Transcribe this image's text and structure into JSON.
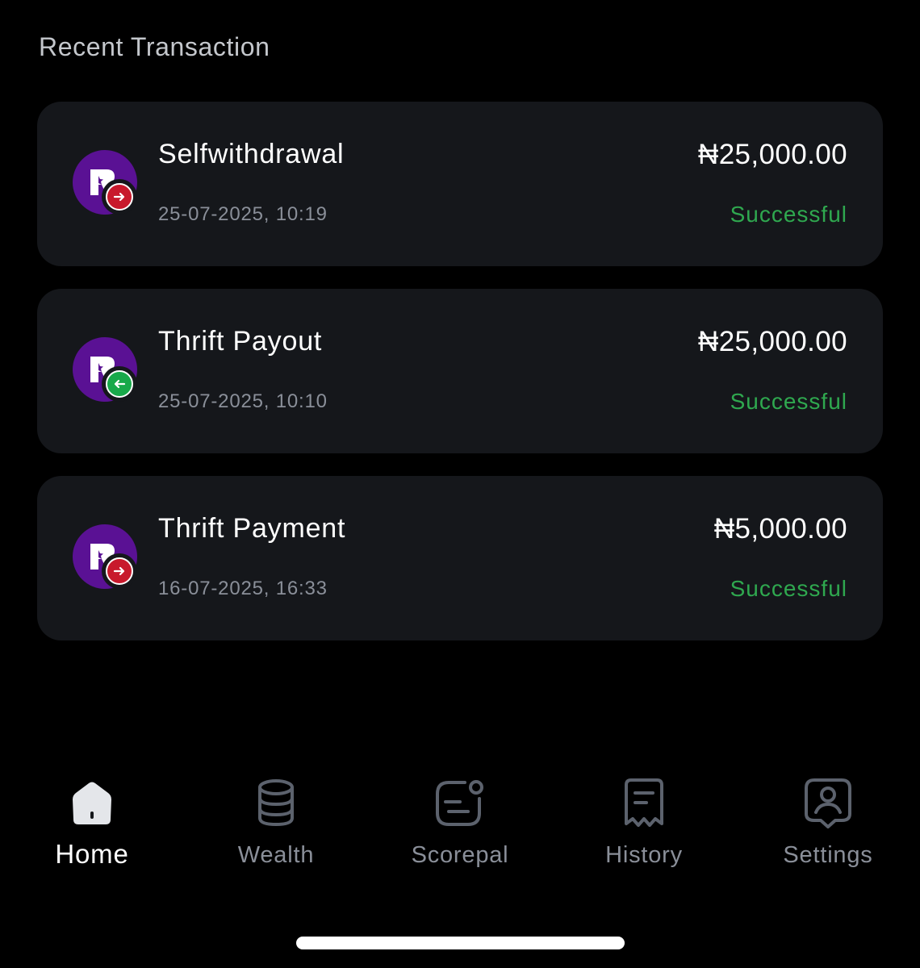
{
  "section_title": "Recent Transaction",
  "transactions": [
    {
      "name": "Selfwithdrawal",
      "date": "25-07-2025, 10:19",
      "amount": "₦25,000.00",
      "status": "Successful",
      "direction": "out",
      "badge_icon": "arrow-right-icon"
    },
    {
      "name": "Thrift Payout",
      "date": "25-07-2025, 10:10",
      "amount": "₦25,000.00",
      "status": "Successful",
      "direction": "in",
      "badge_icon": "arrow-left-icon"
    },
    {
      "name": "Thrift Payment",
      "date": "16-07-2025, 16:33",
      "amount": "₦5,000.00",
      "status": "Successful",
      "direction": "out",
      "badge_icon": "arrow-right-icon"
    }
  ],
  "nav": {
    "items": [
      {
        "label": "Home",
        "icon": "home-icon",
        "active": true
      },
      {
        "label": "Wealth",
        "icon": "coins-stack-icon",
        "active": false
      },
      {
        "label": "Scorepal",
        "icon": "chat-bubble-icon",
        "active": false
      },
      {
        "label": "History",
        "icon": "receipt-icon",
        "active": false
      },
      {
        "label": "Settings",
        "icon": "user-profile-icon",
        "active": false
      }
    ]
  },
  "colors": {
    "background": "#000000",
    "card": "#15171b",
    "avatar": "#5a1194",
    "status_success": "#2fa84f",
    "badge_out": "#c8192c",
    "badge_in": "#18a94a",
    "muted_text": "#8a8f99"
  }
}
